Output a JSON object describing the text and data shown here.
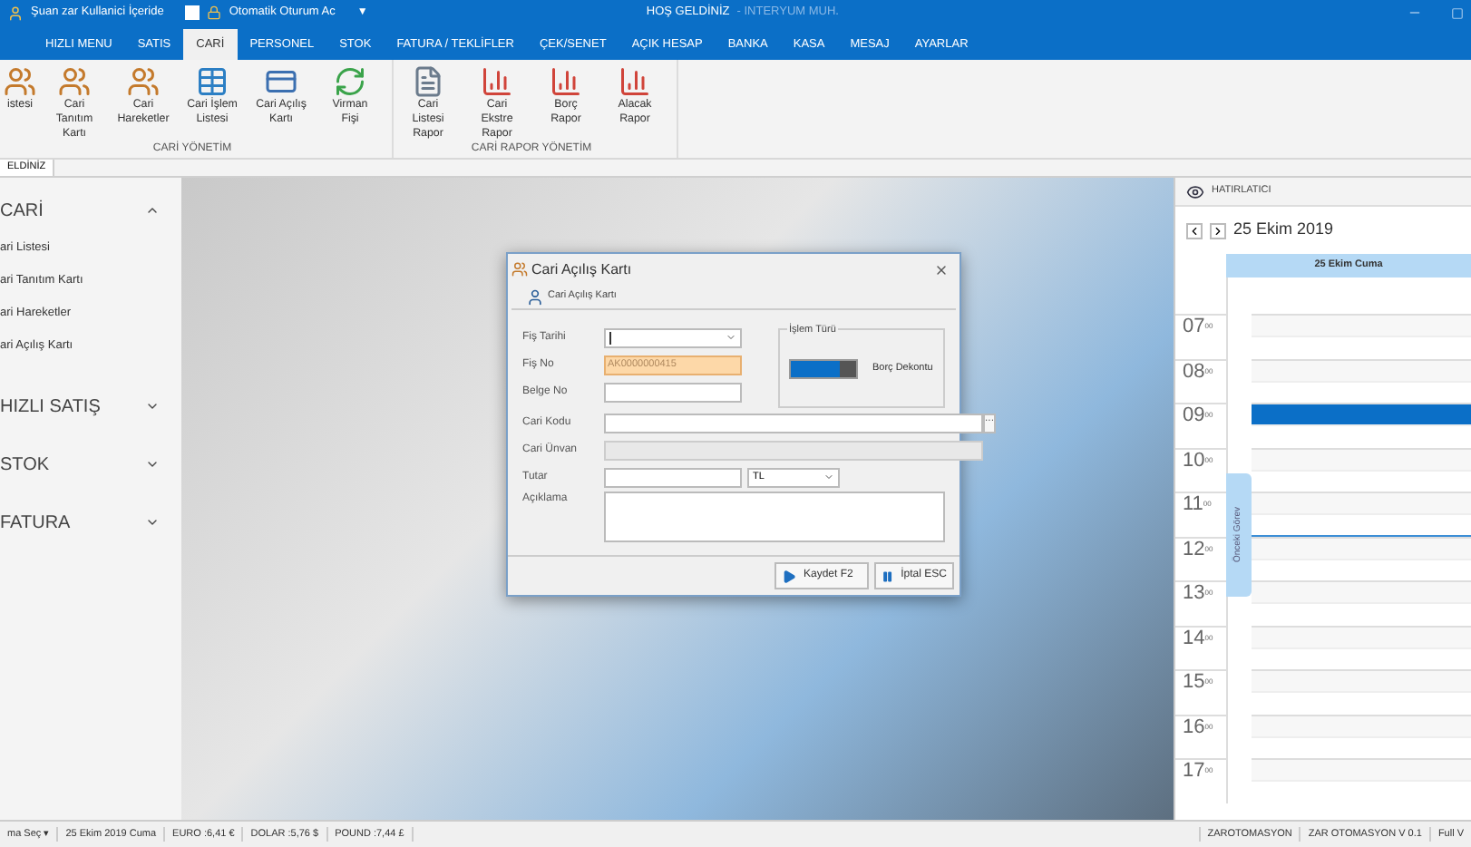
{
  "title_bar": {
    "user_status": "Şuan zar Kullanici İçeride",
    "auto_login": {
      "label": "Otomatik Oturum Ac",
      "checked": false
    },
    "dropdown": "▼",
    "title": "HOŞ GELDİNİZ",
    "subtitle": "- INTERYUM MUH."
  },
  "tabs": [
    {
      "label": "HIZLI MENU",
      "selected": false
    },
    {
      "label": "SATIS",
      "selected": false
    },
    {
      "label": "CARİ",
      "selected": true
    },
    {
      "label": "PERSONEL",
      "selected": false
    },
    {
      "label": "STOK",
      "selected": false
    },
    {
      "label": "FATURA / TEKLİFLER",
      "selected": false
    },
    {
      "label": "ÇEK/SENET",
      "selected": false
    },
    {
      "label": "AÇIK HESAP",
      "selected": false
    },
    {
      "label": "BANKA",
      "selected": false
    },
    {
      "label": "KASA",
      "selected": false
    },
    {
      "label": "MESAJ",
      "selected": false
    },
    {
      "label": "AYARLAR",
      "selected": false
    }
  ],
  "ribbon_groups": [
    {
      "label": "CARİ YÖNETİM",
      "items": [
        {
          "label": "istesi",
          "kind": "people"
        },
        {
          "label": "Cari Tanıtım Kartı",
          "kind": "people"
        },
        {
          "label": "Cari Hareketler",
          "kind": "people"
        },
        {
          "label": "Cari İşlem Listesi",
          "kind": "grid"
        },
        {
          "label": "Cari Açılış Kartı",
          "kind": "card"
        },
        {
          "label": "Virman Fişi",
          "kind": "refresh"
        }
      ]
    },
    {
      "label": "CARİ RAPOR YÖNETİM",
      "items": [
        {
          "label": "Cari Listesi Rapor",
          "kind": "doc"
        },
        {
          "label": "Cari Ekstre Rapor",
          "kind": "chart"
        },
        {
          "label": "Borç Rapor",
          "kind": "chart"
        },
        {
          "label": "Alacak Rapor",
          "kind": "chart"
        }
      ]
    }
  ],
  "document_tab": "ELDİNİZ",
  "sidebar": {
    "groups": [
      {
        "label": "CARİ",
        "expanded": true,
        "items": [
          "ari Listesi",
          "ari Tanıtım Kartı",
          "ari Hareketler",
          "ari Açılış Kartı"
        ]
      },
      {
        "label": "HIZLI SATIŞ",
        "expanded": false
      },
      {
        "label": "STOK",
        "expanded": false
      },
      {
        "label": "FATURA",
        "expanded": false
      }
    ]
  },
  "dialog": {
    "title": "Cari Açılış Kartı",
    "group_tab": "Cari Açılış Kartı",
    "fis_tarihi": {
      "label": "Fiş Tarihi"
    },
    "fis_no": {
      "label": "Fiş No",
      "value": "AK0000000415"
    },
    "belge_no": {
      "label": "Belge No"
    },
    "islem_turu": {
      "label": "İşlem Türü",
      "on": true,
      "value_label": "Borç Dekontu"
    },
    "cari_kodu": {
      "label": "Cari Kodu",
      "button": "···"
    },
    "cari_unvan": {
      "label": "Cari Ünvan",
      "disabled": true
    },
    "tutar": {
      "label": "Tutar",
      "currency": "TL"
    },
    "aciklama": {
      "label": "Açıklama"
    },
    "buttons": [
      "Kaydet F2",
      "İptal ESC"
    ]
  },
  "reminder": {
    "title": "HATIRLATICI",
    "date": "25 Ekim 2019",
    "day_header": "25 Ekim Cuma",
    "side_tab": "Önceki Görev",
    "hours": [
      {
        "hour": "07",
        "minutes": "00",
        "selected": false
      },
      {
        "hour": "08",
        "minutes": "00",
        "selected": false
      },
      {
        "hour": "09",
        "minutes": "00",
        "selected": true
      },
      {
        "hour": "10",
        "minutes": "00",
        "selected": false
      },
      {
        "hour": "11",
        "minutes": "00",
        "selected": false
      },
      {
        "hour": "12",
        "minutes": "00",
        "selected": false
      },
      {
        "hour": "13",
        "minutes": "00",
        "selected": false
      },
      {
        "hour": "14",
        "minutes": "00",
        "selected": false
      },
      {
        "hour": "15",
        "minutes": "00",
        "selected": false
      },
      {
        "hour": "16",
        "minutes": "00",
        "selected": false
      },
      {
        "hour": "17",
        "minutes": "00",
        "selected": false
      }
    ]
  },
  "status_bar": {
    "left": [
      "ma Seç ▾",
      "25 Ekim 2019 Cuma",
      "EURO :6,41 €",
      "DOLAR :5,76 $",
      "POUND :7,44 £"
    ],
    "right": [
      "ZAROTOMASYON",
      "ZAR OTOMASYON V 0.1",
      "Full V"
    ]
  }
}
